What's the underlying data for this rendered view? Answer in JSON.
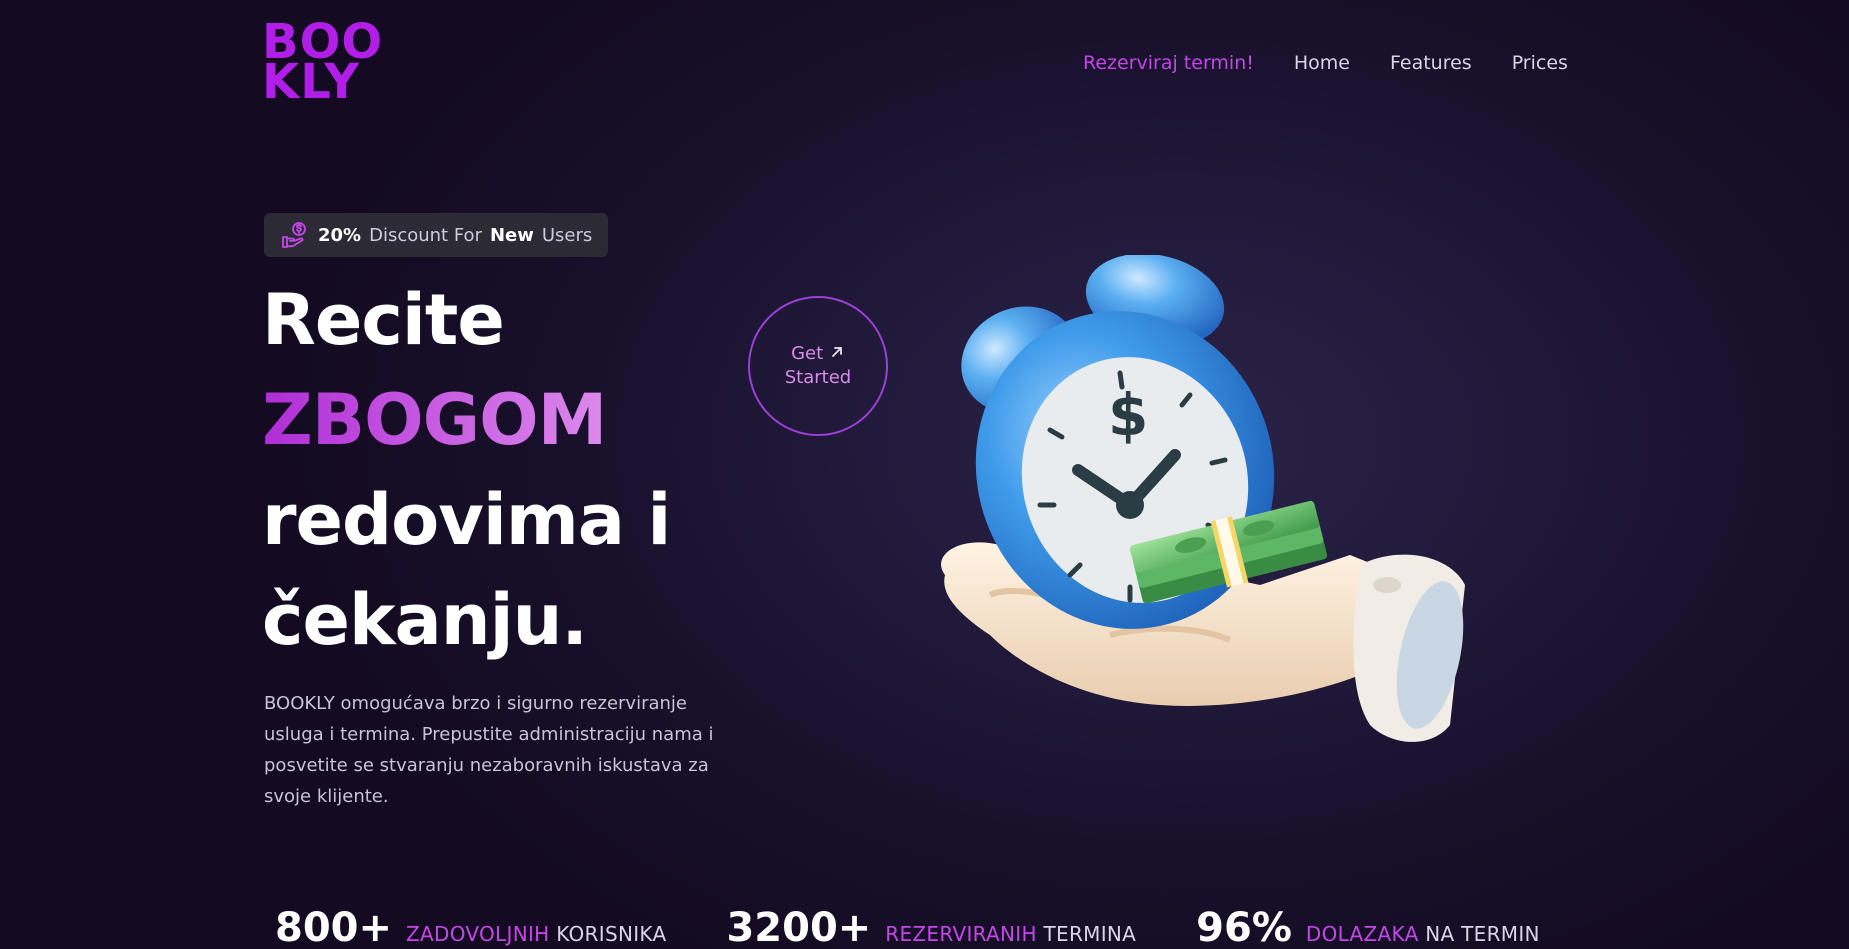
{
  "logo": {
    "line1": "BOO",
    "line2": "KLY"
  },
  "nav": {
    "cta": "Rezerviraj termin!",
    "home": "Home",
    "features": "Features",
    "prices": "Prices"
  },
  "badge": {
    "icon": "hand-coin-icon",
    "percent": "20%",
    "text1": "Discount For",
    "new": "New",
    "text2": "Users"
  },
  "headline": {
    "line1": "Recite",
    "line2": "ZBOGOM",
    "line3": "redovima i",
    "line4": "čekanju."
  },
  "description": "BOOKLY omogućava brzo i sigurno rezerviranje usluga i termina. Prepustite administraciju nama i posvetite se stvaranju nezaboravnih iskustava za svoje klijente.",
  "get_started": {
    "line1": "Get",
    "line2": "Started",
    "icon": "arrow-up-right-icon"
  },
  "hero_image": {
    "icon": "hand-holding-clock-and-money"
  },
  "stats": [
    {
      "num": "800+",
      "label_accent": "ZADOVOLJNIH",
      "label_rest": "KORISNIKA"
    },
    {
      "num": "3200+",
      "label_accent": "REZERVIRANIH",
      "label_rest": "TERMINA"
    },
    {
      "num": "96%",
      "label_accent": "DOLAZAKA",
      "label_rest": "NA TERMIN"
    }
  ],
  "colors": {
    "accent": "#b01ee8",
    "accent_light": "#c447e8",
    "background": "#180f2a"
  }
}
